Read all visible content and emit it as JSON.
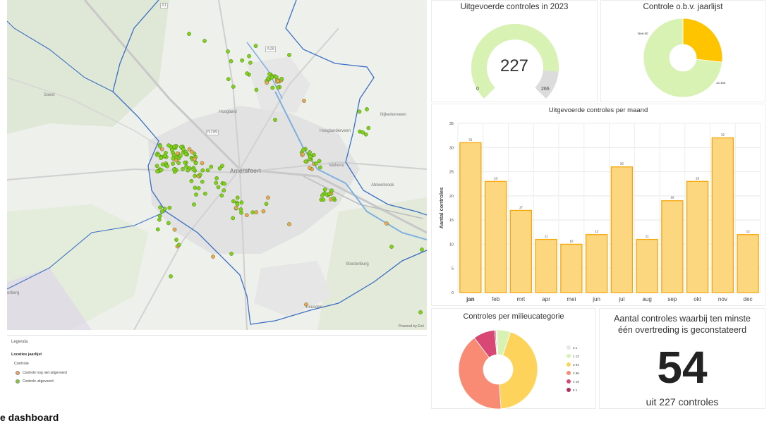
{
  "map": {
    "place_labels": {
      "soest": "Soest",
      "hoogland": "Hoogland",
      "hooglanderveen": "Hooglanderveen",
      "amersfoort": "Amersfoort",
      "nijkerkerveen": "Nijkerkerveen",
      "leusden": "Leusden",
      "stoutenburg": "Stoutenburg",
      "abbenbroek": "Abbenbroek",
      "vathorst": "Vathorst",
      "soesterberg": "orberg",
      "road_n199": "N199",
      "road_a1": "A1",
      "road_a28": "A28"
    },
    "attribution": "Powered by Esri"
  },
  "legend": {
    "title": "Legenda",
    "layer": "Locaties jaarlijst",
    "field": "Controle",
    "items": [
      {
        "label": "Controle nog niet uitgevoerd",
        "color": "#f0a35a"
      },
      {
        "label": "Controle uitgevoerd",
        "color": "#7fd11a"
      }
    ]
  },
  "footer_title": "e dashboard",
  "gauge": {
    "title": "Uitgevoerde controles in 2023",
    "value_text": "227",
    "min_label": "0",
    "max_label": "266",
    "value": 227,
    "max": 266,
    "fill_color": "#d8f2b4",
    "rest_color": "#dcdcdc"
  },
  "donut_jaarlijst": {
    "title": "Controle o.b.v. jaarlijst",
    "slices": [
      {
        "label": "Nee 60",
        "value": 60,
        "color": "#ffc400"
      },
      {
        "label": "Ja 164",
        "value": 164,
        "color": "#d8f2b4"
      }
    ]
  },
  "chart_data": [
    {
      "type": "bar",
      "title": "Uitgevoerde controles per maand",
      "ylabel": "Aantal controles",
      "xlabel": "",
      "categories": [
        "jan",
        "feb",
        "mrt",
        "apr",
        "mei",
        "jun",
        "jul",
        "aug",
        "sep",
        "okt",
        "nov",
        "dec"
      ],
      "values": [
        31,
        23,
        17,
        11,
        10,
        12,
        26,
        11,
        19,
        23,
        32,
        12
      ],
      "ylim": [
        0,
        35
      ],
      "yticks": [
        0,
        5,
        10,
        15,
        20,
        25,
        30,
        35
      ],
      "bar_color": "#fdd680",
      "bar_border": "#f5a70a",
      "grid": true
    }
  ],
  "donut_milieu": {
    "title": "Controles per milieucategorie",
    "slices": [
      {
        "label": "2.1",
        "value": 1,
        "color": "#e6e6e6"
      },
      {
        "label": "1 12",
        "value": 12,
        "color": "#d8f2b4"
      },
      {
        "label": "3 94",
        "value": 94,
        "color": "#fdd35c"
      },
      {
        "label": "2 88",
        "value": 88,
        "color": "#f98b74"
      },
      {
        "label": "4 19",
        "value": 19,
        "color": "#d94874"
      },
      {
        "label": "5 1",
        "value": 1,
        "color": "#b03060"
      }
    ]
  },
  "kpi": {
    "title_line1": "Aantal controles waarbij ten minste",
    "title_line2": "één overtreding is geconstateerd",
    "value": "54",
    "subtitle": "uit 227 controles"
  },
  "colors": {
    "green_point": "#7fd11a",
    "orange_point": "#f0a35a",
    "boundary": "#3b6fc4",
    "water": "#7fb0e0"
  }
}
